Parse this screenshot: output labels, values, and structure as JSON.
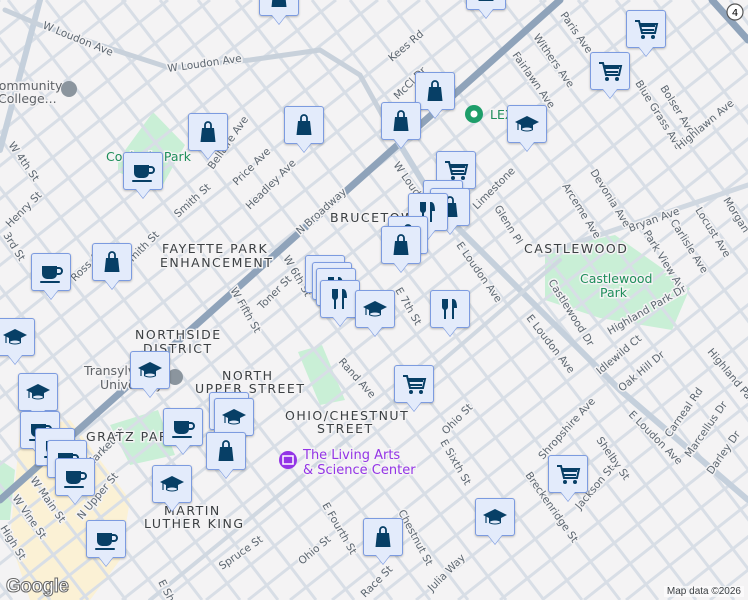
{
  "map": {
    "attribution": "Map data ©2026",
    "logo": "Google",
    "route_shield": "4",
    "colors": {
      "background": "#f4f3f4",
      "road": "#d4dbe3",
      "arterial": "#8fa3ba",
      "park": "#c9efd6",
      "downtown": "#fbf1d5",
      "marker_bg": "#e3ebfb",
      "marker_icon": "#073f66"
    },
    "neighborhoods": [
      "FAYETTE PARK",
      "ENHANCEMENT",
      "BRUCETOWN",
      "CASTLEWOOD",
      "NORTHSIDE",
      "DISTRICT",
      "NORTH",
      "UPPER STREET",
      "OHIO/CHESTNUT",
      "STREET",
      "GRATZ PARK",
      "MARTIN",
      "LUTHER KING"
    ],
    "parks": [
      "Coolavin Park",
      "Castlewood",
      "Park"
    ],
    "pois": [
      "The Living Arts",
      "& Science Center",
      "LEX Bing",
      "Community",
      "College...",
      "Transylvania",
      "University"
    ],
    "streets": [
      "W Loudon Ave",
      "W Loudon Ave",
      "N Broadway",
      "W Loudon Ave",
      "E Loudon Ave",
      "E Loudon Ave",
      "E Loudon Ave",
      "Kees Rd",
      "McCl Dr",
      "Fairlawn Ave",
      "Withers Ave",
      "Paris Ave",
      "Blue Grass Ave",
      "Bolser Ave",
      "Highlawn Ave",
      "Bryan Ave",
      "Devonia Ave",
      "Arceme Ave",
      "Glenn Pl",
      "Limestone",
      "Park View Ave",
      "Carlisle Ave",
      "Locust Ave",
      "Morgan",
      "Castlewood Dr",
      "Highland Park Dr",
      "Idlewild Ct",
      "Oak Hill Dr",
      "Highland Park",
      "Carneal Rd",
      "Marcellus Dr",
      "Darley Dr",
      "Shropshire Ave",
      "Shelby St",
      "Jackson St",
      "Breckenridge St",
      "Ohio St",
      "E Sixth St",
      "Julia Way",
      "Race St",
      "E Fourth St",
      "Ohio St",
      "Spruce St",
      "Rand Ave",
      "E 7th St",
      "W Fifth St",
      "Toner St",
      "W 6th St",
      "Headley Ave",
      "Price Ave",
      "Bellaire Ave",
      "Smith St",
      "Smith St",
      "Ross Ave",
      "W 4th St",
      "Henry St",
      "3rd St",
      "W Main St",
      "W Vine St",
      "High St",
      "N Upper St",
      "Market St",
      "E Short St",
      "Chestnut St"
    ]
  },
  "markers": [
    {
      "type": "shopping"
    },
    {
      "type": "shopping"
    },
    {
      "type": "grocery"
    },
    {
      "type": "grocery"
    },
    {
      "type": "shopping"
    },
    {
      "type": "shopping"
    },
    {
      "type": "school"
    },
    {
      "type": "shopping"
    },
    {
      "type": "shopping"
    },
    {
      "type": "cafe"
    },
    {
      "type": "grocery"
    },
    {
      "type": "shopping"
    },
    {
      "type": "shopping"
    },
    {
      "type": "restaurant"
    },
    {
      "type": "shopping"
    },
    {
      "type": "shopping"
    },
    {
      "type": "restaurant"
    },
    {
      "type": "restaurant"
    },
    {
      "type": "restaurant"
    },
    {
      "type": "restaurant"
    },
    {
      "type": "school"
    },
    {
      "type": "restaurant"
    },
    {
      "type": "shopping"
    },
    {
      "type": "cafe"
    },
    {
      "type": "school"
    },
    {
      "type": "school"
    },
    {
      "type": "school"
    },
    {
      "type": "cafe"
    },
    {
      "type": "cafe"
    },
    {
      "type": "cafe"
    },
    {
      "type": "cafe"
    },
    {
      "type": "school"
    },
    {
      "type": "school"
    },
    {
      "type": "cafe"
    },
    {
      "type": "shopping"
    },
    {
      "type": "school"
    },
    {
      "type": "cafe"
    },
    {
      "type": "grocery"
    },
    {
      "type": "grocery"
    },
    {
      "type": "school"
    },
    {
      "type": "shopping"
    }
  ]
}
